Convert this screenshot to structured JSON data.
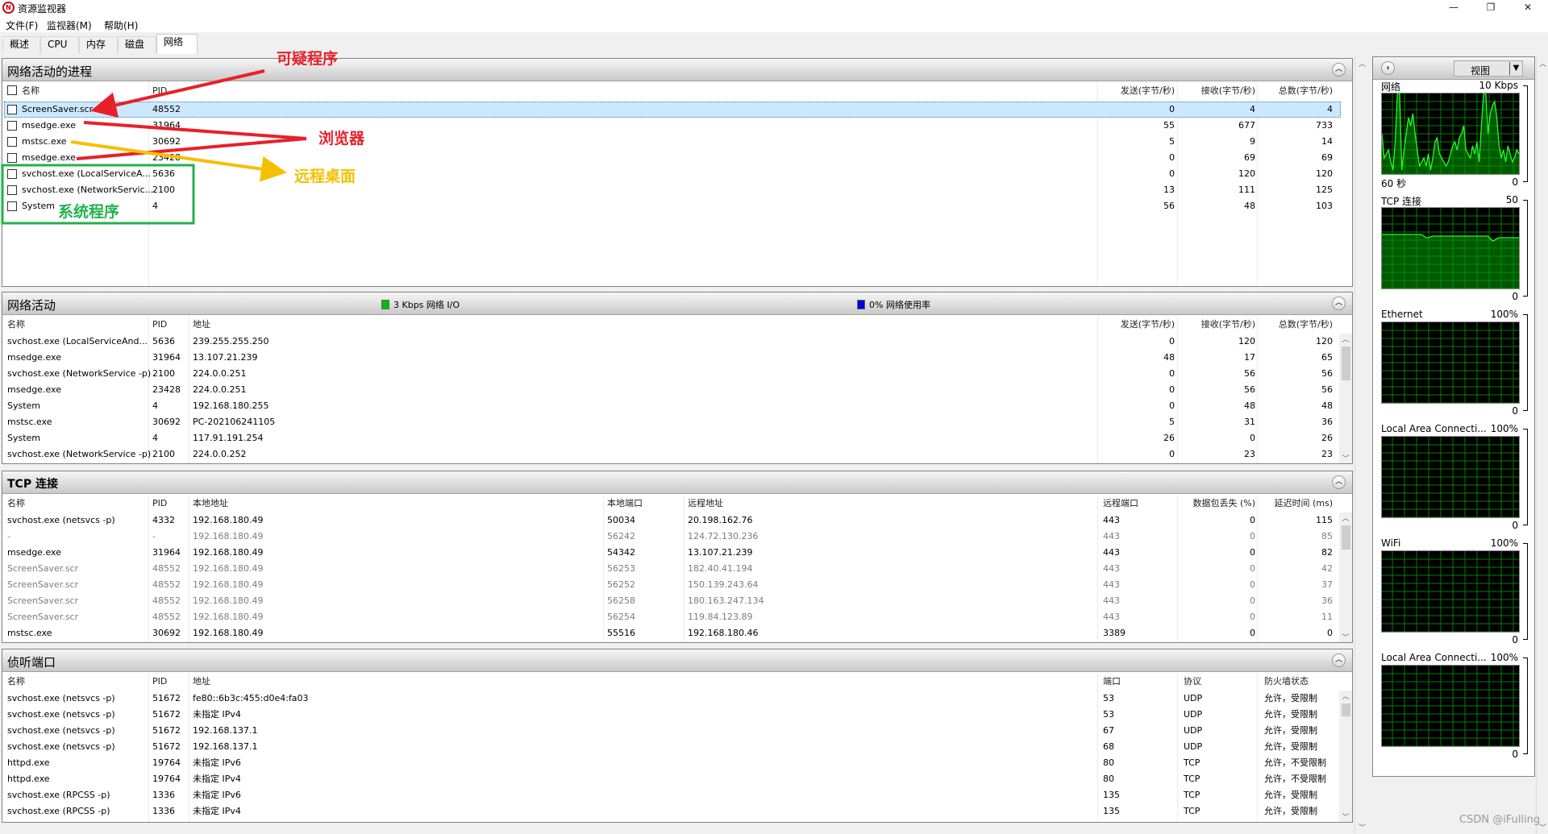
{
  "window": {
    "title": "资源监视器",
    "app_icon": "resource-monitor-icon"
  },
  "menu": [
    "文件(F)",
    "监视器(M)",
    "帮助(H)"
  ],
  "tabs": [
    {
      "label": "概述"
    },
    {
      "label": "CPU"
    },
    {
      "label": "内存"
    },
    {
      "label": "磁盘"
    },
    {
      "label": "网络",
      "active": true
    }
  ],
  "processes": {
    "title": "网络活动的进程",
    "headers": [
      "名称",
      "PID",
      "发送(字节/秒)",
      "接收(字节/秒)",
      "总数(字节/秒)"
    ],
    "rows": [
      {
        "name": "ScreenSaver.scr",
        "pid": "48552",
        "send": "0",
        "recv": "4",
        "total": "4",
        "selected": true
      },
      {
        "name": "msedge.exe",
        "pid": "31964",
        "send": "55",
        "recv": "677",
        "total": "733"
      },
      {
        "name": "mstsc.exe",
        "pid": "30692",
        "send": "5",
        "recv": "9",
        "total": "14"
      },
      {
        "name": "msedge.exe",
        "pid": "23428",
        "send": "0",
        "recv": "69",
        "total": "69"
      },
      {
        "name": "svchost.exe (LocalServiceA...",
        "pid": "5636",
        "send": "0",
        "recv": "120",
        "total": "120"
      },
      {
        "name": "svchost.exe (NetworkServic...",
        "pid": "2100",
        "send": "13",
        "recv": "111",
        "total": "125"
      },
      {
        "name": "System",
        "pid": "4",
        "send": "56",
        "recv": "48",
        "total": "103"
      }
    ]
  },
  "activity": {
    "title": "网络活动",
    "io_label": "3 Kbps 网络 I/O",
    "io_color": "#00c000",
    "usage_label": "0% 网络使用率",
    "usage_color": "#0000d0",
    "headers": [
      "名称",
      "PID",
      "地址",
      "发送(字节/秒)",
      "接收(字节/秒)",
      "总数(字节/秒)"
    ],
    "rows": [
      {
        "name": "svchost.exe (LocalServiceAnd...",
        "pid": "5636",
        "addr": "239.255.255.250",
        "send": "0",
        "recv": "120",
        "total": "120"
      },
      {
        "name": "msedge.exe",
        "pid": "31964",
        "addr": "13.107.21.239",
        "send": "48",
        "recv": "17",
        "total": "65"
      },
      {
        "name": "svchost.exe (NetworkService -p)",
        "pid": "2100",
        "addr": "224.0.0.251",
        "send": "0",
        "recv": "56",
        "total": "56"
      },
      {
        "name": "msedge.exe",
        "pid": "23428",
        "addr": "224.0.0.251",
        "send": "0",
        "recv": "56",
        "total": "56"
      },
      {
        "name": "System",
        "pid": "4",
        "addr": "192.168.180.255",
        "send": "0",
        "recv": "48",
        "total": "48"
      },
      {
        "name": "mstsc.exe",
        "pid": "30692",
        "addr": "PC-202106241105",
        "send": "5",
        "recv": "31",
        "total": "36"
      },
      {
        "name": "System",
        "pid": "4",
        "addr": "117.91.191.254",
        "send": "26",
        "recv": "0",
        "total": "26"
      },
      {
        "name": "svchost.exe (NetworkService -p)",
        "pid": "2100",
        "addr": "224.0.0.252",
        "send": "0",
        "recv": "23",
        "total": "23"
      }
    ]
  },
  "tcp": {
    "title": "TCP 连接",
    "headers": [
      "名称",
      "PID",
      "本地地址",
      "本地端口",
      "远程地址",
      "远程端口",
      "数据包丢失 (%)",
      "延迟时间 (ms)"
    ],
    "rows": [
      {
        "name": "svchost.exe (netsvcs -p)",
        "pid": "4332",
        "laddr": "192.168.180.49",
        "lport": "50034",
        "raddr": "20.198.162.76",
        "rport": "443",
        "loss": "0",
        "lat": "115"
      },
      {
        "name": "-",
        "pid": "-",
        "laddr": "192.168.180.49",
        "lport": "56242",
        "raddr": "124.72.130.236",
        "rport": "443",
        "loss": "0",
        "lat": "85",
        "dim": true
      },
      {
        "name": "msedge.exe",
        "pid": "31964",
        "laddr": "192.168.180.49",
        "lport": "54342",
        "raddr": "13.107.21.239",
        "rport": "443",
        "loss": "0",
        "lat": "82"
      },
      {
        "name": "ScreenSaver.scr",
        "pid": "48552",
        "laddr": "192.168.180.49",
        "lport": "56253",
        "raddr": "182.40.41.194",
        "rport": "443",
        "loss": "0",
        "lat": "42",
        "dim": true
      },
      {
        "name": "ScreenSaver.scr",
        "pid": "48552",
        "laddr": "192.168.180.49",
        "lport": "56252",
        "raddr": "150.139.243.64",
        "rport": "443",
        "loss": "0",
        "lat": "37",
        "dim": true
      },
      {
        "name": "ScreenSaver.scr",
        "pid": "48552",
        "laddr": "192.168.180.49",
        "lport": "56258",
        "raddr": "180.163.247.134",
        "rport": "443",
        "loss": "0",
        "lat": "36",
        "dim": true
      },
      {
        "name": "ScreenSaver.scr",
        "pid": "48552",
        "laddr": "192.168.180.49",
        "lport": "56254",
        "raddr": "119.84.123.89",
        "rport": "443",
        "loss": "0",
        "lat": "11",
        "dim": true
      },
      {
        "name": "mstsc.exe",
        "pid": "30692",
        "laddr": "192.168.180.49",
        "lport": "55516",
        "raddr": "192.168.180.46",
        "rport": "3389",
        "loss": "0",
        "lat": "0"
      }
    ]
  },
  "listen": {
    "title": "侦听端口",
    "headers": [
      "名称",
      "PID",
      "地址",
      "端口",
      "协议",
      "防火墙状态"
    ],
    "rows": [
      {
        "name": "svchost.exe (netsvcs -p)",
        "pid": "51672",
        "addr": "fe80::6b3c:455:d0e4:fa03",
        "port": "53",
        "proto": "UDP",
        "fw": "允许，受限制"
      },
      {
        "name": "svchost.exe (netsvcs -p)",
        "pid": "51672",
        "addr": "未指定 IPv4",
        "port": "53",
        "proto": "UDP",
        "fw": "允许，受限制"
      },
      {
        "name": "svchost.exe (netsvcs -p)",
        "pid": "51672",
        "addr": "192.168.137.1",
        "port": "67",
        "proto": "UDP",
        "fw": "允许，受限制"
      },
      {
        "name": "svchost.exe (netsvcs -p)",
        "pid": "51672",
        "addr": "192.168.137.1",
        "port": "68",
        "proto": "UDP",
        "fw": "允许，受限制"
      },
      {
        "name": "httpd.exe",
        "pid": "19764",
        "addr": "未指定 IPv6",
        "port": "80",
        "proto": "TCP",
        "fw": "允许，不受限制"
      },
      {
        "name": "httpd.exe",
        "pid": "19764",
        "addr": "未指定 IPv4",
        "port": "80",
        "proto": "TCP",
        "fw": "允许，不受限制"
      },
      {
        "name": "svchost.exe (RPCSS -p)",
        "pid": "1336",
        "addr": "未指定 IPv6",
        "port": "135",
        "proto": "TCP",
        "fw": "允许，受限制"
      },
      {
        "name": "svchost.exe (RPCSS -p)",
        "pid": "1336",
        "addr": "未指定 IPv4",
        "port": "135",
        "proto": "TCP",
        "fw": "允许，受限制"
      }
    ]
  },
  "right_panel": {
    "view_label": "视图",
    "graphs": [
      {
        "label": "网络",
        "max": "10 Kbps",
        "min": "0",
        "time": "60 秒",
        "values": [
          50,
          20,
          25,
          30,
          15,
          5,
          40,
          100,
          100,
          5,
          30,
          50,
          70,
          60,
          75,
          50,
          30,
          10,
          15,
          20,
          10,
          25,
          5,
          20,
          40,
          45,
          25,
          20,
          15,
          10,
          15,
          25,
          35,
          40,
          30,
          45,
          50,
          60,
          30,
          25,
          20,
          35,
          25,
          40,
          15,
          60,
          100,
          100,
          50,
          75,
          85,
          90,
          70,
          35,
          20,
          30,
          15,
          35,
          25,
          15,
          20,
          30,
          25
        ]
      },
      {
        "label": "TCP 连接",
        "max": "50",
        "min": "0",
        "values": [
          67,
          67,
          67,
          67,
          67,
          67,
          67,
          67,
          67,
          67,
          67,
          67,
          67,
          67,
          67,
          67,
          67,
          67,
          67,
          65,
          63,
          63,
          64,
          65,
          65,
          65,
          65,
          65,
          65,
          65,
          65,
          65,
          65,
          65,
          65,
          65,
          65,
          65,
          65,
          65,
          65,
          65,
          65,
          65,
          65,
          65,
          65,
          65,
          65,
          62,
          59,
          60,
          62,
          63,
          63,
          63,
          63,
          63,
          63,
          63,
          63,
          63,
          63
        ]
      },
      {
        "label": "Ethernet",
        "max": "100%",
        "min": "0",
        "values": []
      },
      {
        "label": "Local Area Connecti...",
        "max": "100%",
        "min": "0",
        "values": []
      },
      {
        "label": "WiFi",
        "max": "100%",
        "min": "0",
        "values": []
      },
      {
        "label": "Local Area Connecti...",
        "max": "100%",
        "min": "0",
        "values": []
      }
    ]
  },
  "annotations": {
    "suspicious": "可疑程序",
    "browser": "浏览器",
    "remote_desktop": "远程桌面",
    "system": "系统程序",
    "red": "#e8202a",
    "yellow": "#f5c000",
    "green": "#22b14c"
  },
  "watermark": "CSDN @iFulling"
}
